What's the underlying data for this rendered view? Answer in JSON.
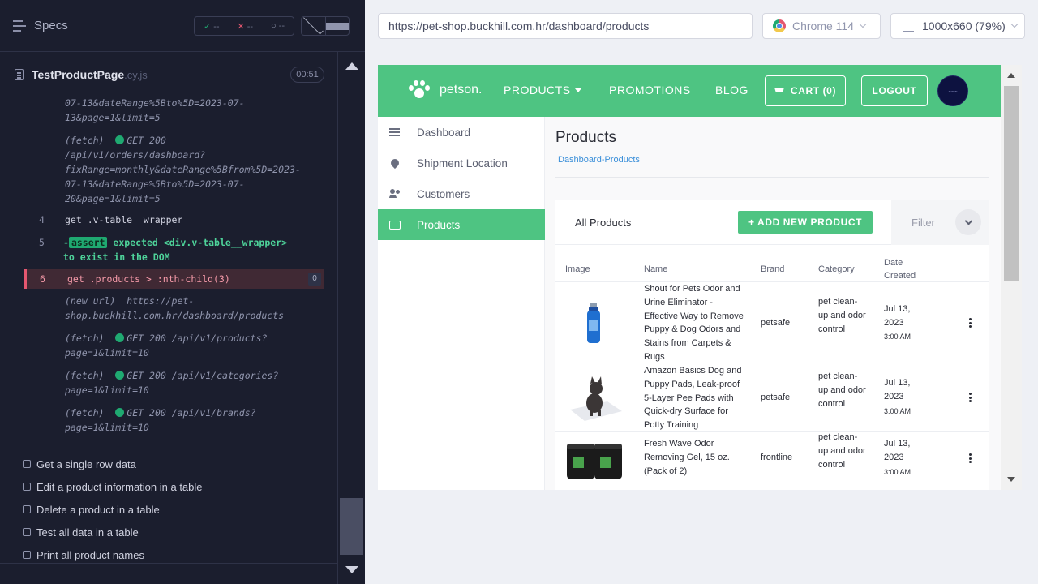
{
  "reporter": {
    "title": "Specs",
    "stats": {
      "passed": "--",
      "failed": "--",
      "pending": "--"
    },
    "spec_file": {
      "name": "TestProductPage",
      "ext": ".cy.js",
      "duration": "00:51"
    },
    "commands": {
      "c1_text": "07-13&dateRange%5Bto%5D=2023-07-\n13&page=1&limit=5",
      "c2_prefix": "(fetch)",
      "c2_text": "GET 200\n/api/v1/orders/dashboard?\nfixRange=monthly&dateRange%5Bfrom%5D=2023-\n07-13&dateRange%5Bto%5D=2023-07-\n20&page=1&limit=5",
      "c4_num": "4",
      "c4_body": "get  .v-table__wrapper",
      "c5_num": "5",
      "c5_badge": "assert",
      "c5_body_1": "expected <div.v-table__wrapper>",
      "c5_body_2": "to exist in the DOM",
      "c6_num": "6",
      "c6_body": "get  .products > :nth-child(3)",
      "c6_count": "0",
      "c7_text": "(new url)  https://pet-\nshop.buckhill.com.hr/dashboard/products",
      "c8_prefix": "(fetch)",
      "c8_text": "GET 200 /api/v1/products?\npage=1&limit=10",
      "c9_prefix": "(fetch)",
      "c9_text": "GET 200 /api/v1/categories?\npage=1&limit=10",
      "c10_prefix": "(fetch)",
      "c10_text": "GET 200 /api/v1/brands?\npage=1&limit=10"
    },
    "tests": [
      "Get a single row data",
      "Edit a product information in a table",
      "Delete a product in a table",
      "Test all data in a table",
      "Print all product names"
    ]
  },
  "browser": {
    "url": "https://pet-shop.buckhill.com.hr/dashboard/products",
    "browser_name": "Chrome 114",
    "viewport": "1000x660  (79%)"
  },
  "app": {
    "logo": "petson.",
    "nav": {
      "products": "PRODUCTS",
      "promotions": "PROMOTIONS",
      "blog": "BLOG"
    },
    "cart": "CART (0)",
    "logout": "LOGOUT",
    "avatar_text": "avatar",
    "sidebar": [
      "Dashboard",
      "Shipment Location",
      "Customers",
      "Products"
    ],
    "page_title": "Products",
    "breadcrumb": "Dashboard-Products",
    "table_title": "All Products",
    "add_button": "+ ADD NEW PRODUCT",
    "filter": "Filter",
    "columns": {
      "image": "Image",
      "name": "Name",
      "brand": "Brand",
      "category": "Category",
      "date": "Date\nCreated"
    },
    "rows": [
      {
        "name": "Shout for Pets Odor and Urine Eliminator - Effective Way to Remove Puppy & Dog Odors and Stains from Carpets & Rugs",
        "brand": "petsafe",
        "category": "pet clean-up and odor control",
        "date": "Jul 13, 2023",
        "time": "3:00 AM"
      },
      {
        "name": "Amazon Basics Dog and Puppy Pads, Leak-proof 5-Layer Pee Pads with Quick-dry Surface for Potty Training",
        "brand": "petsafe",
        "category": "pet clean-up and odor control",
        "date": "Jul 13, 2023",
        "time": "3:00 AM"
      },
      {
        "name": "Fresh Wave Odor Removing Gel, 15 oz. (Pack of 2)",
        "brand": "frontline",
        "category": "pet clean-up and odor control",
        "date": "Jul 13, 2023",
        "time": "3:00 AM"
      }
    ]
  },
  "colors": {
    "brand_green": "#4ec482",
    "link_blue": "#3a8fd9",
    "reporter_bg": "#1b1e2e",
    "pass": "#1fa971",
    "fail": "#e45770"
  }
}
